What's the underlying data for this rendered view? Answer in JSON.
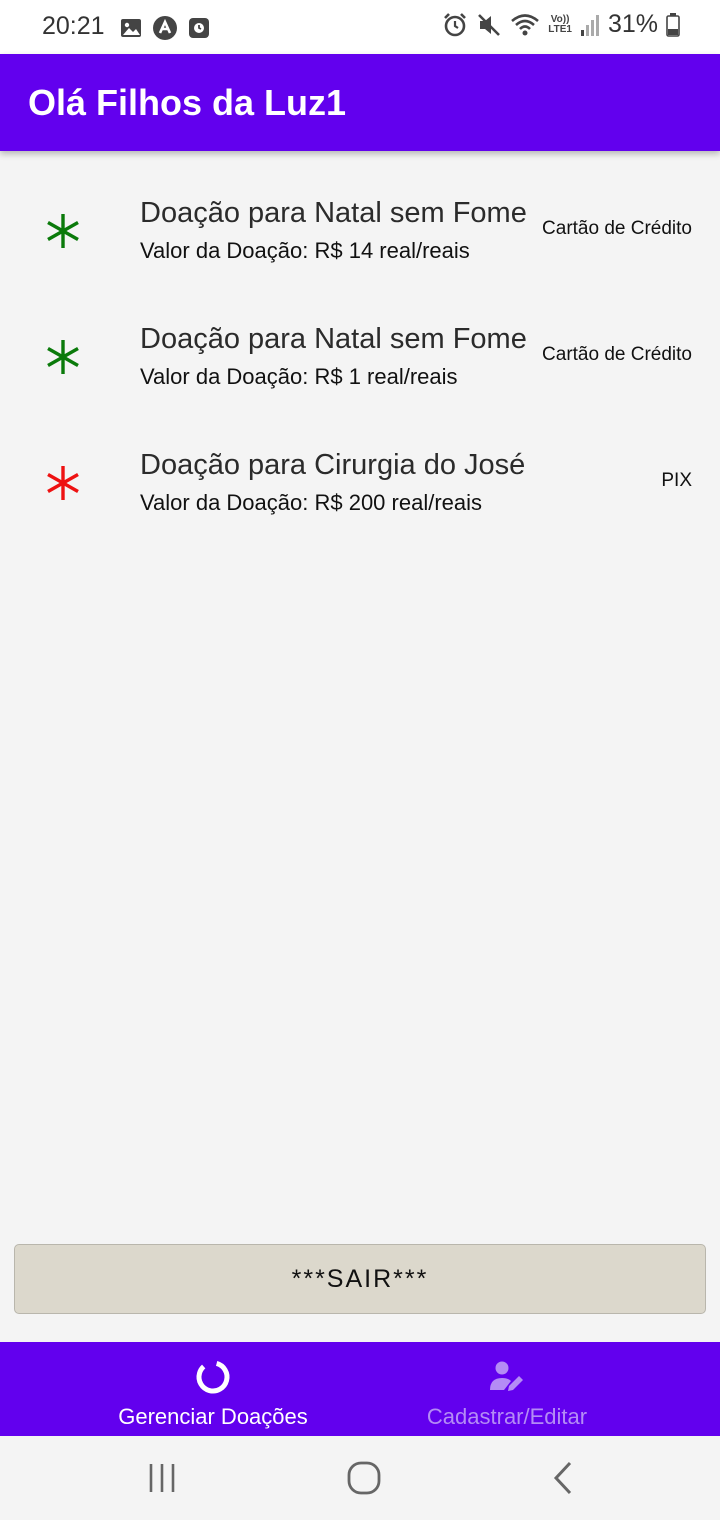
{
  "status_bar": {
    "time": "20:21",
    "battery_percent": "31%",
    "icons": [
      "image-icon",
      "app-a-icon",
      "app-square-icon",
      "alarm-icon",
      "mute-icon",
      "wifi-icon",
      "volte-lte1-icon",
      "signal-icon",
      "battery-icon"
    ],
    "volte_top": "Vo))",
    "volte_bottom": "LTE1"
  },
  "app_bar": {
    "title": "Olá Filhos da Luz1",
    "color": "#6200ee"
  },
  "donations": [
    {
      "title": "Doação para Natal sem Fome",
      "value": "Valor da Doação: R$ 14 real/reais",
      "method": "Cartão de Crédito",
      "icon": "asterisk-icon",
      "icon_color": "#0a7a0a"
    },
    {
      "title": "Doação para Natal sem Fome",
      "value": "Valor da Doação: R$ 1 real/reais",
      "method": "Cartão de Crédito",
      "icon": "asterisk-icon",
      "icon_color": "#0a7a0a"
    },
    {
      "title": "Doação para Cirurgia do José",
      "value": "Valor da Doação: R$ 200 real/reais",
      "method": "PIX",
      "icon": "asterisk-icon",
      "icon_color": "#ee1111"
    }
  ],
  "exit_button": {
    "label": "***SAIR***"
  },
  "bottom_nav": {
    "items": [
      {
        "label": "Gerenciar Doações",
        "icon": "ring-icon",
        "active": true,
        "color": "#ffffff"
      },
      {
        "label": "Cadastrar/Editar",
        "icon": "user-edit-icon",
        "active": false,
        "color": "#b48cf5"
      }
    ]
  },
  "system_nav": {
    "buttons": [
      "recents-icon",
      "home-icon",
      "back-icon"
    ]
  }
}
